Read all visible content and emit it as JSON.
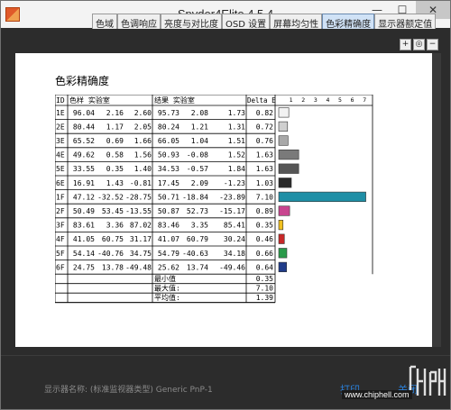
{
  "window": {
    "title": "Spyder4Elite 4.5.4",
    "controls": {
      "minimize": "—",
      "maximize": "☐",
      "close": "✕"
    }
  },
  "tabs": [
    {
      "label": "色域",
      "active": false
    },
    {
      "label": "色调响应",
      "active": false
    },
    {
      "label": "亮度与对比度",
      "active": false
    },
    {
      "label": "OSD 设置",
      "active": false
    },
    {
      "label": "屏幕均匀性",
      "active": false
    },
    {
      "label": "色彩精确度",
      "active": true
    },
    {
      "label": "显示器额定值",
      "active": false
    }
  ],
  "zoom_tools": {
    "zoom_in": "+",
    "zoom_fit": "◎",
    "zoom_out": "−"
  },
  "report": {
    "title": "色彩精确度",
    "headers": {
      "id": "ID",
      "target": "色样 实验室",
      "result": "结果 实验室",
      "delta": "Delta E"
    },
    "scale_ticks": [
      "1",
      "2",
      "3",
      "4",
      "5",
      "6",
      "7"
    ],
    "summary": [
      {
        "label": "最小值",
        "value": "0.35"
      },
      {
        "label": "最大值:",
        "value": "7.10"
      },
      {
        "label": "平均值:",
        "value": "1.39"
      }
    ]
  },
  "chart_data": {
    "type": "bar",
    "title": "色彩精确度",
    "xlim": [
      0,
      7.5
    ],
    "rows": [
      {
        "id": "1E",
        "target": [
          "96.04",
          "2.16",
          "2.60"
        ],
        "result": [
          "95.73",
          "2.08",
          "1.73"
        ],
        "delta": 0.82,
        "delta_text": "0.82",
        "color": "#f2f2f2"
      },
      {
        "id": "2E",
        "target": [
          "80.44",
          "1.17",
          "2.05"
        ],
        "result": [
          "80.24",
          "1.21",
          "1.31"
        ],
        "delta": 0.72,
        "delta_text": "0.72",
        "color": "#cfcfcf"
      },
      {
        "id": "3E",
        "target": [
          "65.52",
          "0.69",
          "1.66"
        ],
        "result": [
          "66.05",
          "1.04",
          "1.51"
        ],
        "delta": 0.76,
        "delta_text": "0.76",
        "color": "#a8a8a8"
      },
      {
        "id": "4E",
        "target": [
          "49.62",
          "0.58",
          "1.56"
        ],
        "result": [
          "50.93",
          "-0.08",
          "1.52"
        ],
        "delta": 1.63,
        "delta_text": "1.63",
        "color": "#7a7a7a"
      },
      {
        "id": "5E",
        "target": [
          "33.55",
          "0.35",
          "1.40"
        ],
        "result": [
          "34.53",
          "-0.57",
          "1.84"
        ],
        "delta": 1.63,
        "delta_text": "1.63",
        "color": "#565656"
      },
      {
        "id": "6E",
        "target": [
          "16.91",
          "1.43",
          "-0.81"
        ],
        "result": [
          "17.45",
          "2.09",
          "-1.23"
        ],
        "delta": 1.03,
        "delta_text": "1.03",
        "color": "#2a2a2a"
      },
      {
        "id": "1F",
        "target": [
          "47.12",
          "-32.52",
          "-28.75"
        ],
        "result": [
          "50.71",
          "-18.84",
          "-23.89"
        ],
        "delta": 7.1,
        "delta_text": "7.10",
        "color": "#1f8fa6"
      },
      {
        "id": "2F",
        "target": [
          "50.49",
          "53.45",
          "-13.55"
        ],
        "result": [
          "50.87",
          "52.73",
          "-15.17"
        ],
        "delta": 0.89,
        "delta_text": "0.89",
        "color": "#c8458f"
      },
      {
        "id": "3F",
        "target": [
          "83.61",
          "3.36",
          "87.02"
        ],
        "result": [
          "83.46",
          "3.35",
          "85.41"
        ],
        "delta": 0.35,
        "delta_text": "0.35",
        "color": "#f0c020"
      },
      {
        "id": "4F",
        "target": [
          "41.05",
          "60.75",
          "31.17"
        ],
        "result": [
          "41.07",
          "60.79",
          "30.24"
        ],
        "delta": 0.46,
        "delta_text": "0.46",
        "color": "#c82828"
      },
      {
        "id": "5F",
        "target": [
          "54.14",
          "-40.76",
          "34.75"
        ],
        "result": [
          "54.79",
          "-40.63",
          "34.18"
        ],
        "delta": 0.66,
        "delta_text": "0.66",
        "color": "#2a9a4a"
      },
      {
        "id": "6F",
        "target": [
          "24.75",
          "13.78",
          "-49.48"
        ],
        "result": [
          "25.62",
          "13.74",
          "-49.46"
        ],
        "delta": 0.64,
        "delta_text": "0.64",
        "color": "#203c8a"
      }
    ]
  },
  "footer": {
    "display_name": "显示器名称: (标准监视器类型) Generic PnP-1",
    "print_label": "打印",
    "close_label": "关闭"
  },
  "watermark": {
    "url": "www.chiphell.com"
  }
}
